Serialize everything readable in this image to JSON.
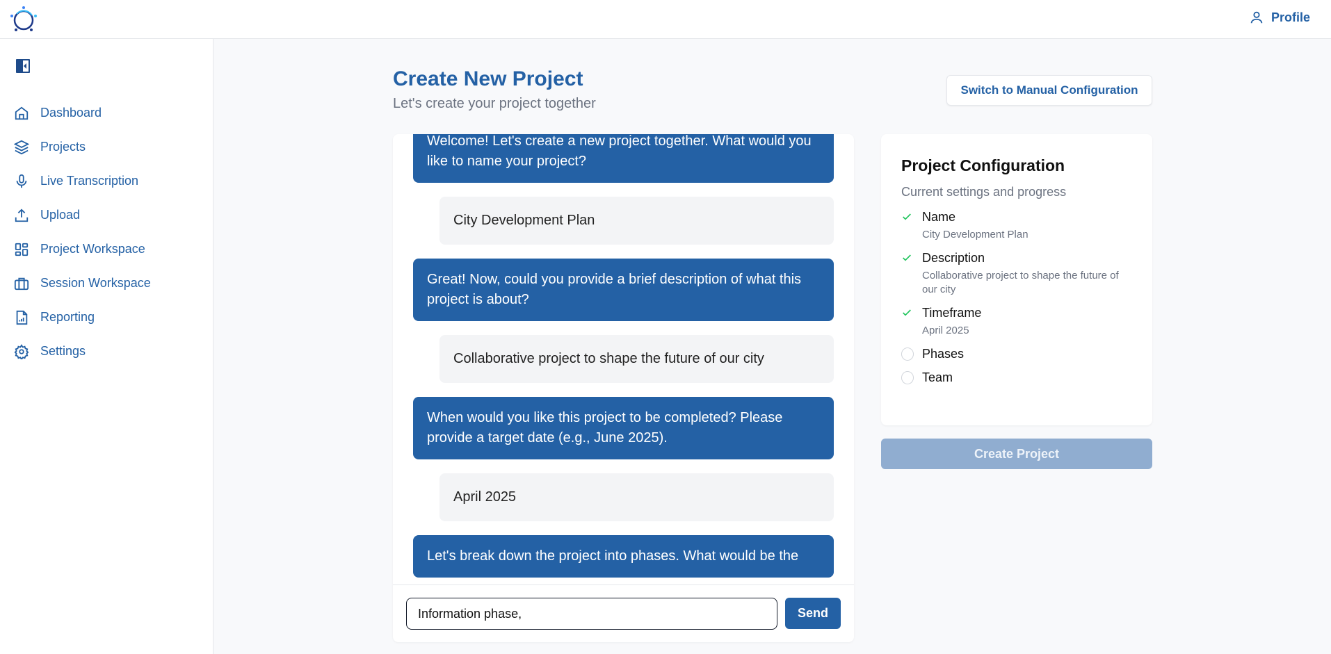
{
  "header": {
    "profile_label": "Profile"
  },
  "sidebar": {
    "items": [
      {
        "label": "Dashboard",
        "icon": "home-icon"
      },
      {
        "label": "Projects",
        "icon": "layers-icon"
      },
      {
        "label": "Live Transcription",
        "icon": "microphone-icon"
      },
      {
        "label": "Upload",
        "icon": "upload-icon"
      },
      {
        "label": "Project Workspace",
        "icon": "grid-icon"
      },
      {
        "label": "Session Workspace",
        "icon": "briefcase-icon"
      },
      {
        "label": "Reporting",
        "icon": "report-icon"
      },
      {
        "label": "Settings",
        "icon": "gear-icon"
      }
    ]
  },
  "main": {
    "title": "Create New Project",
    "subtitle": "Let's create your project together",
    "switch_label": "Switch to Manual Configuration"
  },
  "chat": {
    "messages": [
      {
        "role": "bot",
        "text": "Welcome! Let's create a new project together. What would you like to name your project?"
      },
      {
        "role": "user",
        "text": "City Development Plan"
      },
      {
        "role": "bot",
        "text": "Great! Now, could you provide a brief description of what this project is about?"
      },
      {
        "role": "user",
        "text": "Collaborative project to shape the future of our city"
      },
      {
        "role": "bot",
        "text": "When would you like this project to be completed? Please provide a target date (e.g., June 2025)."
      },
      {
        "role": "user",
        "text": "April 2025"
      },
      {
        "role": "bot",
        "text": "Let's break down the project into phases. What would be the"
      }
    ],
    "input_value": "Information phase, ",
    "send_label": "Send"
  },
  "config": {
    "title": "Project Configuration",
    "subtitle": "Current settings and progress",
    "items": [
      {
        "label": "Name",
        "value": "City Development Plan",
        "done": true
      },
      {
        "label": "Description",
        "value": "Collaborative project to shape the future of our city",
        "done": true
      },
      {
        "label": "Timeframe",
        "value": "April 2025",
        "done": true
      },
      {
        "label": "Phases",
        "done": false
      },
      {
        "label": "Team",
        "done": false
      }
    ],
    "create_label": "Create Project"
  },
  "colors": {
    "accent": "#2461a5",
    "check": "#22c55e",
    "disabled_button": "#90add0"
  }
}
